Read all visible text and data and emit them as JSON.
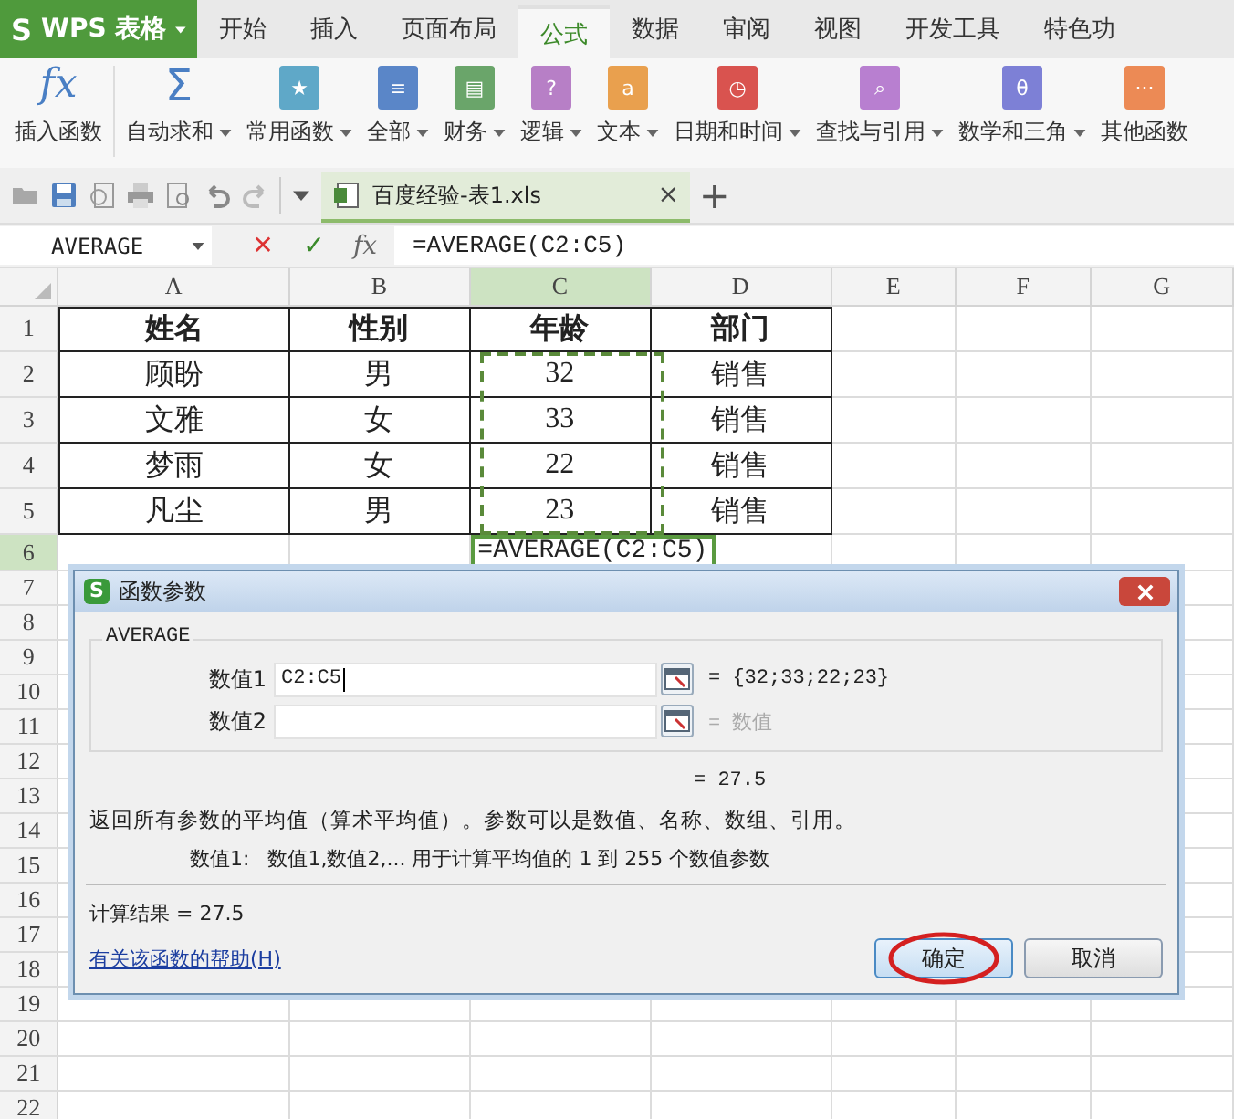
{
  "app_menu": {
    "logo": "S",
    "label": "WPS 表格"
  },
  "tabs": [
    {
      "label": "开始",
      "selected": false
    },
    {
      "label": "插入",
      "selected": false
    },
    {
      "label": "页面布局",
      "selected": false
    },
    {
      "label": "公式",
      "selected": true
    },
    {
      "label": "数据",
      "selected": false
    },
    {
      "label": "审阅",
      "selected": false
    },
    {
      "label": "视图",
      "selected": false
    },
    {
      "label": "开发工具",
      "selected": false
    },
    {
      "label": "特色功",
      "selected": false
    }
  ],
  "ribbon": [
    {
      "kind": "fx",
      "glyph": "fx",
      "label": "插入函数",
      "dropdown": false
    },
    {
      "kind": "sigma",
      "glyph": "Σ",
      "label": "自动求和",
      "dropdown": true
    },
    {
      "kind": "book",
      "glyph": "★",
      "color": "#5fa8c8",
      "label": "常用函数",
      "dropdown": true
    },
    {
      "kind": "book",
      "glyph": "≡",
      "color": "#5a86c8",
      "label": "全部",
      "dropdown": true
    },
    {
      "kind": "book",
      "glyph": "▤",
      "color": "#6aa56a",
      "label": "财务",
      "dropdown": true
    },
    {
      "kind": "book",
      "glyph": "?",
      "color": "#b77fc6",
      "label": "逻辑",
      "dropdown": true
    },
    {
      "kind": "book",
      "glyph": "a",
      "color": "#e9a04e",
      "label": "文本",
      "dropdown": true
    },
    {
      "kind": "book",
      "glyph": "◷",
      "color": "#d9534f",
      "label": "日期和时间",
      "dropdown": true
    },
    {
      "kind": "book",
      "glyph": "⌕",
      "color": "#b87fd0",
      "label": "查找与引用",
      "dropdown": true
    },
    {
      "kind": "book",
      "glyph": "θ",
      "color": "#7d80d6",
      "label": "数学和三角",
      "dropdown": true
    },
    {
      "kind": "book",
      "glyph": "···",
      "color": "#ec8a55",
      "label": "其他函数",
      "dropdown": false
    }
  ],
  "document_tab": {
    "title": "百度经验-表1.xls",
    "close": "×",
    "new": "+"
  },
  "formula_bar": {
    "name_box": "AVERAGE",
    "cancel": "✕",
    "enter": "✓",
    "fx": "fx",
    "formula": "=AVERAGE(C2:C5)"
  },
  "sheet": {
    "columns": [
      {
        "label": "A",
        "selected": false
      },
      {
        "label": "B",
        "selected": false
      },
      {
        "label": "C",
        "selected": true
      },
      {
        "label": "D",
        "selected": false
      },
      {
        "label": "E",
        "selected": false
      },
      {
        "label": "F",
        "selected": false
      },
      {
        "label": "G",
        "selected": false
      }
    ],
    "rows": [
      {
        "label": "1",
        "selected": false,
        "bold": true,
        "cells": [
          "姓名",
          "性别",
          "年龄",
          "部门"
        ]
      },
      {
        "label": "2",
        "selected": false,
        "bold": false,
        "cells": [
          "顾盼",
          "男",
          "32",
          "销售"
        ]
      },
      {
        "label": "3",
        "selected": false,
        "bold": false,
        "cells": [
          "文雅",
          "女",
          "33",
          "销售"
        ]
      },
      {
        "label": "4",
        "selected": false,
        "bold": false,
        "cells": [
          "梦雨",
          "女",
          "22",
          "销售"
        ]
      },
      {
        "label": "5",
        "selected": false,
        "bold": false,
        "cells": [
          "凡尘",
          "男",
          "23",
          "销售"
        ]
      },
      {
        "label": "6",
        "selected": true,
        "editing": "=AVERAGE(C2:C5)"
      },
      {
        "label": "7",
        "selected": false
      },
      {
        "label": "8",
        "selected": false
      },
      {
        "label": "9",
        "selected": false
      },
      {
        "label": "10",
        "selected": false
      },
      {
        "label": "11",
        "selected": false
      },
      {
        "label": "12",
        "selected": false
      },
      {
        "label": "13",
        "selected": false
      },
      {
        "label": "14",
        "selected": false
      },
      {
        "label": "15",
        "selected": false
      },
      {
        "label": "16",
        "selected": false
      },
      {
        "label": "17",
        "selected": false
      },
      {
        "label": "18",
        "selected": false
      },
      {
        "label": "19",
        "selected": false
      },
      {
        "label": "20",
        "selected": false
      },
      {
        "label": "21",
        "selected": false
      },
      {
        "label": "22",
        "selected": false
      }
    ]
  },
  "dialog": {
    "logo": "S",
    "title": "函数参数",
    "function": "AVERAGE",
    "arguments": [
      {
        "label": "数值1",
        "value": "C2:C5",
        "result": "= {32;33;22;23}",
        "result_dimmed": false
      },
      {
        "label": "数值2",
        "result": "= 数值",
        "result_dimmed": true
      }
    ],
    "formula_result": "= 27.5",
    "description": "返回所有参数的平均值（算术平均值）。参数可以是数值、名称、数组、引用。",
    "argument_help_label": "数值1:",
    "argument_help": "数值1,数值2,... 用于计算平均值的 1 到 255 个数值参数",
    "calc_result": "计算结果 = 27.5",
    "help_link": "有关该函数的帮助(H)",
    "buttons": [
      {
        "label": "确定",
        "circled": true
      },
      {
        "label": "取消",
        "circled": false
      }
    ]
  }
}
